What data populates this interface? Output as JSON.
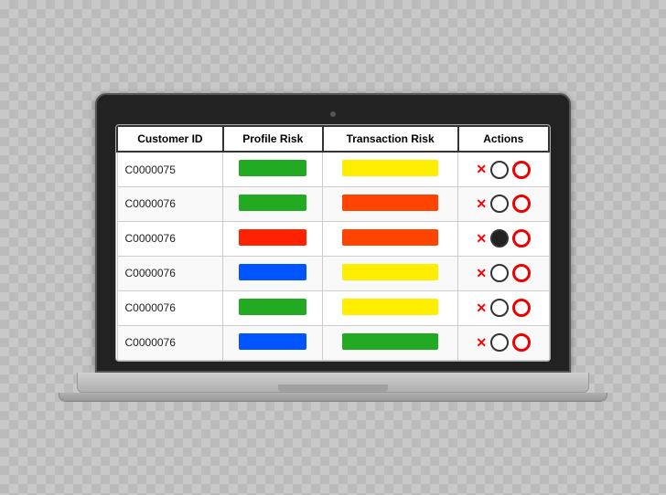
{
  "table": {
    "headers": [
      "Customer ID",
      "Profile Risk",
      "Transaction Risk",
      "Actions"
    ],
    "rows": [
      {
        "customerId": "C0000075",
        "profileRiskColor": "#22aa22",
        "transactionRiskColor": "#ffee00",
        "actionX": "✕",
        "circleType": "empty",
        "hasRedCircle": true
      },
      {
        "customerId": "C0000076",
        "profileRiskColor": "#22aa22",
        "transactionRiskColor": "#ff4400",
        "actionX": "✕",
        "circleType": "empty",
        "hasRedCircle": true
      },
      {
        "customerId": "C0000076",
        "profileRiskColor": "#ff2200",
        "transactionRiskColor": "#ff4400",
        "actionX": "✕",
        "circleType": "filled",
        "hasRedCircle": true
      },
      {
        "customerId": "C0000076",
        "profileRiskColor": "#0055ff",
        "transactionRiskColor": "#ffee00",
        "actionX": "✕",
        "circleType": "empty",
        "hasRedCircle": true
      },
      {
        "customerId": "C0000076",
        "profileRiskColor": "#22aa22",
        "transactionRiskColor": "#ffee00",
        "actionX": "✕",
        "circleType": "empty",
        "hasRedCircle": true
      },
      {
        "customerId": "C0000076",
        "profileRiskColor": "#0055ff",
        "transactionRiskColor": "#22aa22",
        "actionX": "✕",
        "circleType": "empty",
        "hasRedCircle": true
      }
    ]
  }
}
